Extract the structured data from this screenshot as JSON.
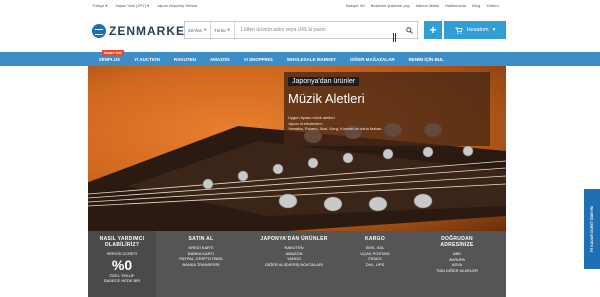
{
  "topbar": {
    "language": "Türkçe ▾",
    "currency": "Japon Yeni (JPY) ▾",
    "service": "Japon Alışveriş Servisi",
    "balance": "Bakiye: ¥0",
    "links": [
      "Bekleme yükleme yap",
      "İsteme listesi",
      "Hakkımızda",
      "Blog",
      "Yardım"
    ]
  },
  "header": {
    "logo_text": "ZENMARKET",
    "search": {
      "site_select": "Zenfoe",
      "type_select": "Türkü",
      "placeholder": "Lütfen ürünün adını veya URL'si yazın"
    },
    "plus_label": "+",
    "account_label": "Hesabım"
  },
  "nav": {
    "badge": "ÜCRET YOK",
    "items": [
      "ZENPLUS",
      "YI AUCTION",
      "RAKUTEN",
      "AMAZON",
      "YI SHOPPING",
      "WHOLESALE MARKET",
      "DİĞER MAĞAZALAR",
      "BENİM İÇİN BUL"
    ]
  },
  "hero": {
    "tag": "Japonya'dan ürünler",
    "title": "Müzik Aletleri",
    "desc1": "Uygun fiyata müzik aletleri",
    "desc2": "Japon üreticilerden:",
    "desc3": "Yamaha, Roland, Akai, Korg, Komaki ve daha fazlası."
  },
  "info": {
    "col1": {
      "h1": "NASIL YARDIMCI",
      "h2": "OLABİLİRİZ?",
      "l1": "SERVİS ÜCRETİ",
      "big": "%0",
      "l2": "ÖZEL TEKLİF",
      "l3": "SADECE HEDE BİR"
    },
    "col2": {
      "title": "SATIN AL",
      "lines": [
        "KREDİ KARTI",
        "BANKA KARTI",
        "PAYPAL, KRİPTO PARA",
        "BANKA TRANSFERİ"
      ]
    },
    "col3": {
      "title": "JAPONYA'DAN ÜRÜNLER",
      "lines": [
        "RAKUTEN",
        "AMAZON",
        "YAHOO",
        "DİĞER ALIŞVERİŞ NOKTALARI"
      ]
    },
    "col4": {
      "title": "KARGO",
      "lines": [
        "EMS, SAL",
        "UÇAK POSTASI",
        "FEDEX",
        "DHL, UPS"
      ]
    },
    "col5": {
      "title1": "DOĞRUDAN",
      "title2": "ADRESİNİZE",
      "lines": [
        "ABD",
        "AVRUPA",
        "ASYA",
        "TÜM DİĞER ÜLKELER"
      ]
    }
  },
  "side_tab": "İYİ KADAR ÜCRET ÖDEYİN!",
  "colors": {
    "brand_blue": "#3c8dc8",
    "button_blue": "#2f9fd6",
    "footer_gray": "#555555",
    "badge_red": "#e84a2a"
  }
}
